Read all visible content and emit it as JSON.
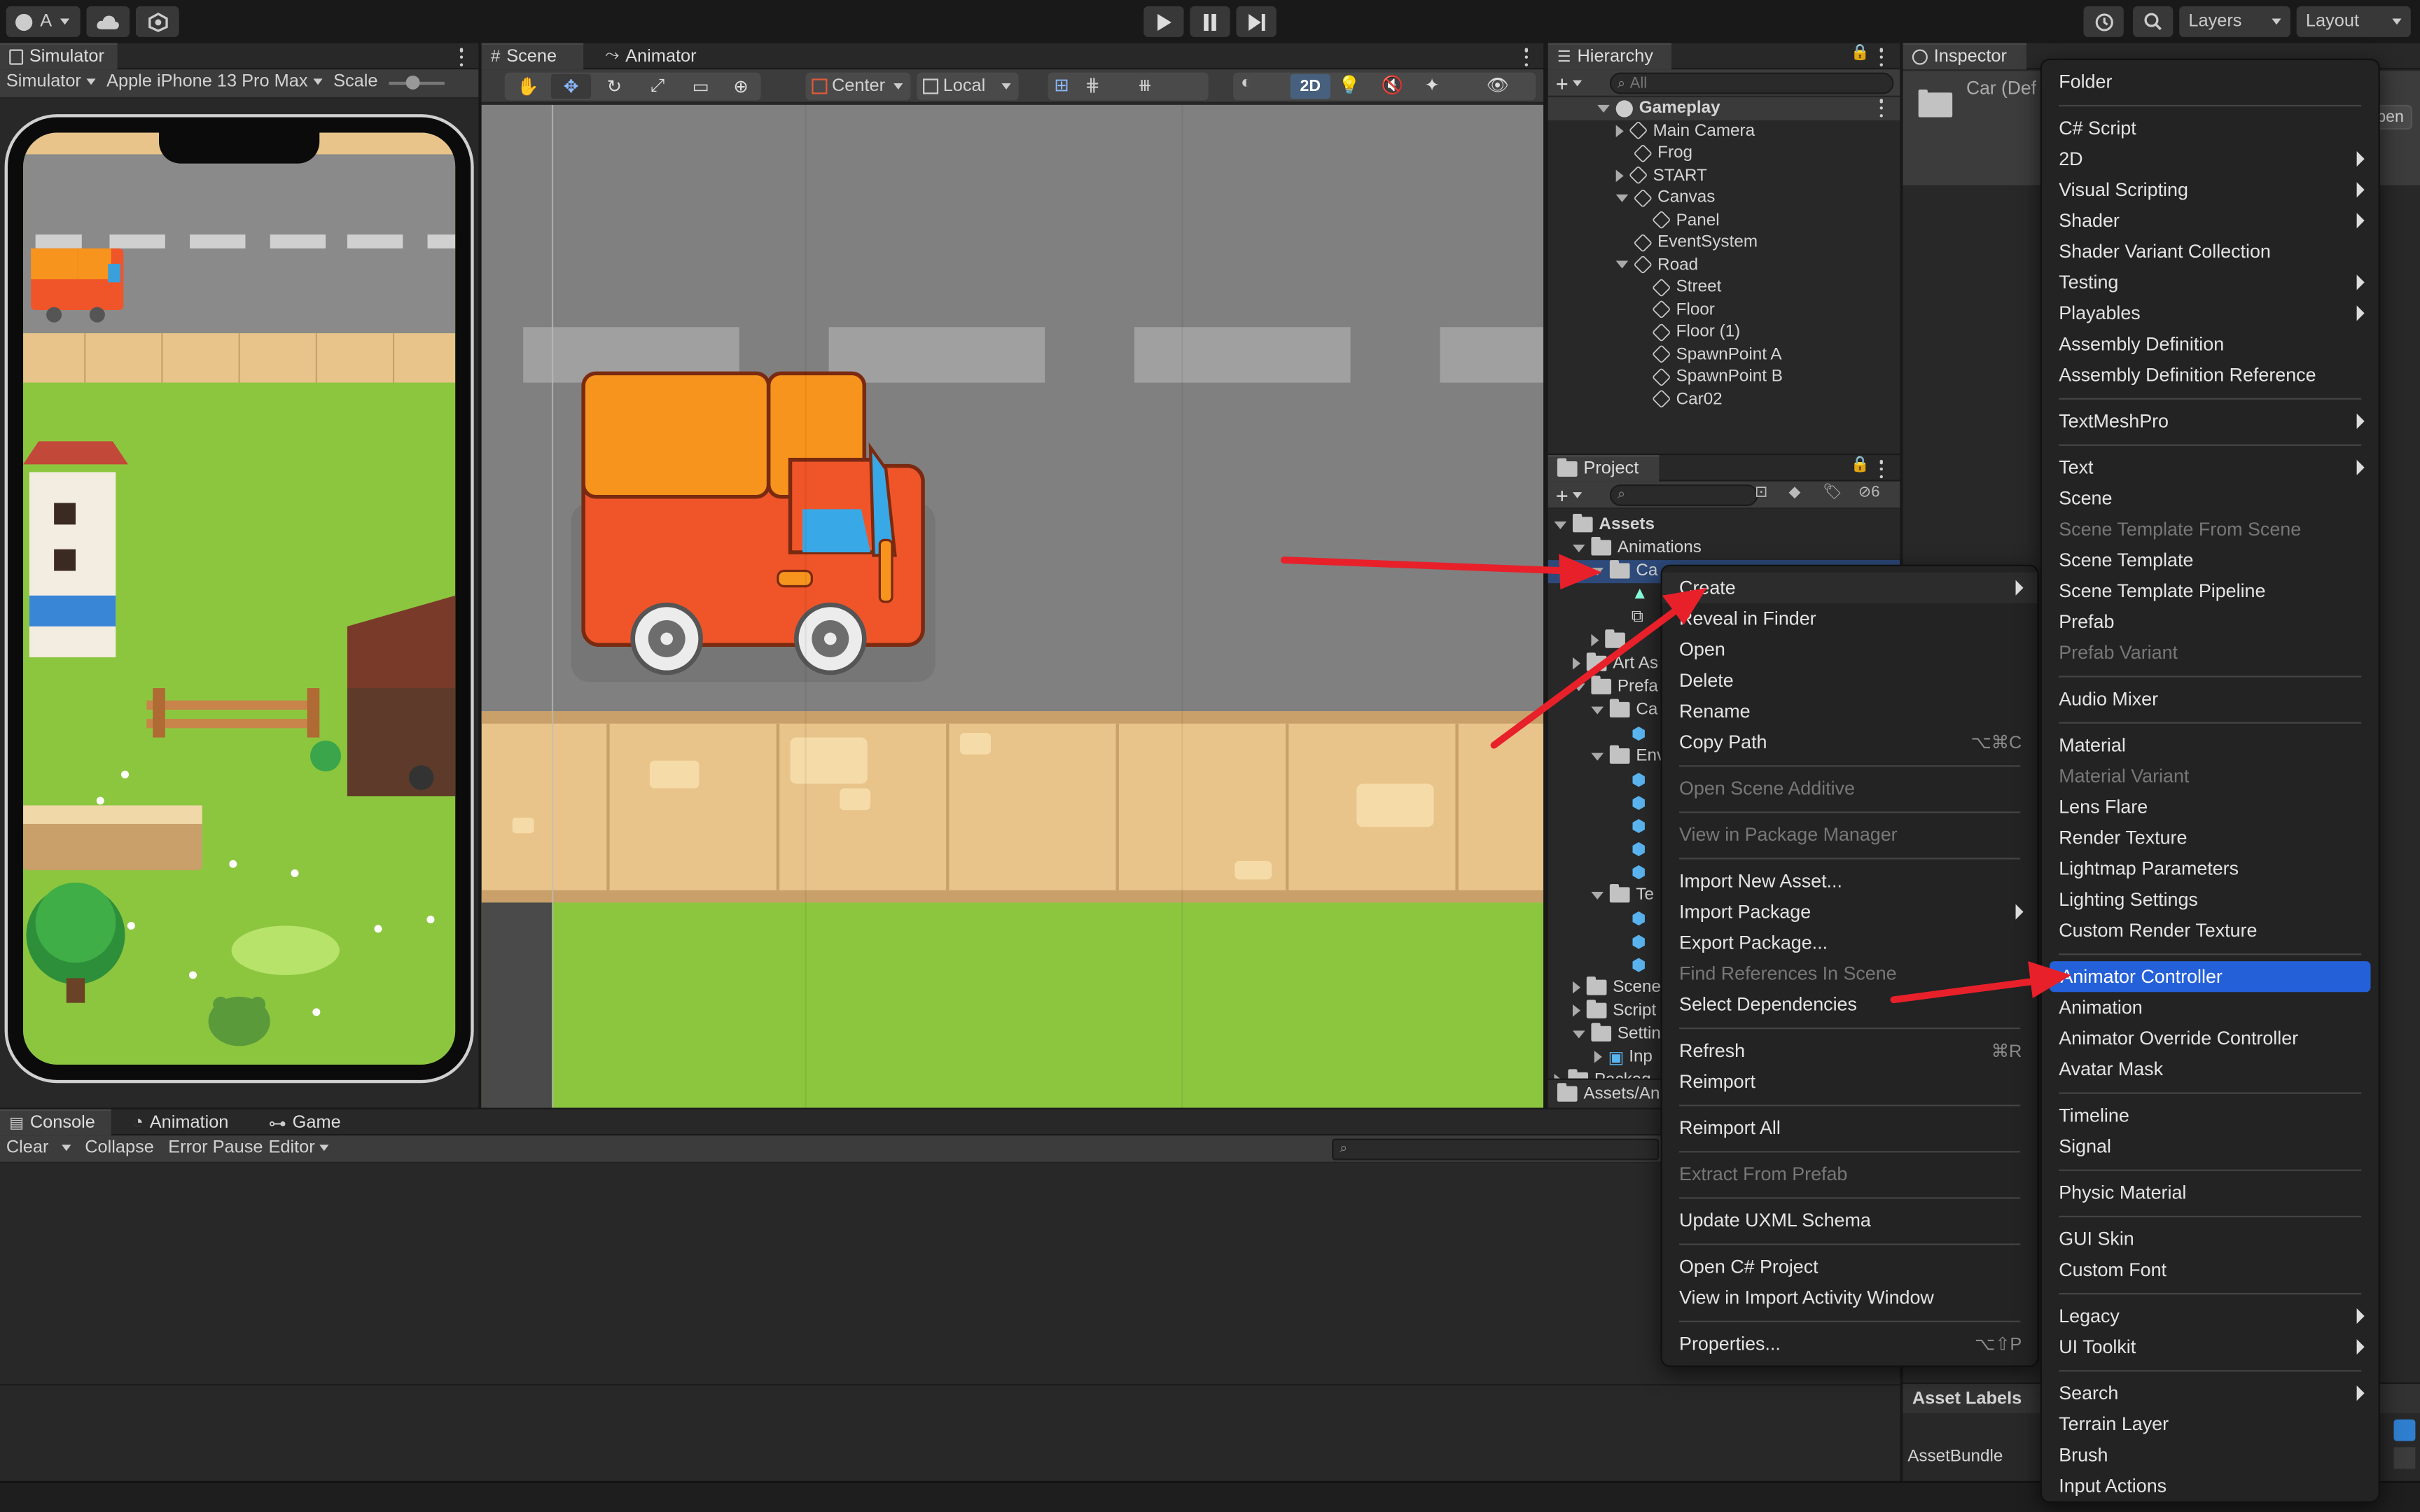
{
  "toolbar": {
    "account_label": "A",
    "layers_label": "Layers",
    "layout_label": "Layout"
  },
  "simulator": {
    "tab": "Simulator",
    "mode": "Simulator",
    "device": "Apple iPhone 13 Pro Max",
    "scale_label": "Scale"
  },
  "scene": {
    "tab_scene": "Scene",
    "tab_animator": "Animator",
    "pivot": "Center",
    "space": "Local",
    "mode_2d": "2D"
  },
  "hierarchy": {
    "tab": "Hierarchy",
    "search_placeholder": "All",
    "root": "Gameplay",
    "items": [
      {
        "label": "Main Camera",
        "indent": 1,
        "expander": "right"
      },
      {
        "label": "Frog",
        "indent": 1,
        "expander": "none"
      },
      {
        "label": "START",
        "indent": 1,
        "expander": "right"
      },
      {
        "label": "Canvas",
        "indent": 1,
        "expander": "down"
      },
      {
        "label": "Panel",
        "indent": 2,
        "expander": "none"
      },
      {
        "label": "EventSystem",
        "indent": 1,
        "expander": "none"
      },
      {
        "label": "Road",
        "indent": 1,
        "expander": "down"
      },
      {
        "label": "Street",
        "indent": 2,
        "expander": "none"
      },
      {
        "label": "Floor",
        "indent": 2,
        "expander": "none"
      },
      {
        "label": "Floor (1)",
        "indent": 2,
        "expander": "none"
      },
      {
        "label": "SpawnPoint A",
        "indent": 2,
        "expander": "none"
      },
      {
        "label": "SpawnPoint B",
        "indent": 2,
        "expander": "none"
      },
      {
        "label": "Car02",
        "indent": 2,
        "expander": "none"
      }
    ]
  },
  "project": {
    "tab": "Project",
    "hidden_count": "6",
    "assets": "Assets",
    "animations": "Animations",
    "selected_folder": "Ca",
    "visible_items": [
      "Art As",
      "Prefa",
      "Ca",
      "Env",
      "Te",
      "Scene",
      "Script",
      "Settin",
      "Inp",
      "Packag"
    ],
    "breadcrumb": "Assets/Ani"
  },
  "inspector": {
    "tab": "Inspector",
    "title": "Car (Def",
    "open_button": "pen",
    "asset_labels": "Asset Labels",
    "asset_bundle": "AssetBundle"
  },
  "console": {
    "tabs": [
      "Console",
      "Animation",
      "Game"
    ],
    "buttons": [
      "Clear",
      "Collapse",
      "Error Pause",
      "Editor"
    ]
  },
  "context_menu": {
    "items": [
      {
        "label": "Create",
        "submenu": true,
        "highlight_soft": true
      },
      {
        "label": "Reveal in Finder"
      },
      {
        "label": "Open"
      },
      {
        "label": "Delete"
      },
      {
        "label": "Rename"
      },
      {
        "label": "Copy Path",
        "shortcut": "⌥⌘C"
      },
      {
        "sep": true
      },
      {
        "label": "Open Scene Additive",
        "disabled": true
      },
      {
        "sep": true
      },
      {
        "label": "View in Package Manager",
        "disabled": true
      },
      {
        "sep": true
      },
      {
        "label": "Import New Asset..."
      },
      {
        "label": "Import Package",
        "submenu": true
      },
      {
        "label": "Export Package..."
      },
      {
        "label": "Find References In Scene",
        "disabled": true
      },
      {
        "label": "Select Dependencies"
      },
      {
        "sep": true
      },
      {
        "label": "Refresh",
        "shortcut": "⌘R"
      },
      {
        "label": "Reimport"
      },
      {
        "sep": true
      },
      {
        "label": "Reimport All"
      },
      {
        "sep": true
      },
      {
        "label": "Extract From Prefab",
        "disabled": true
      },
      {
        "sep": true
      },
      {
        "label": "Update UXML Schema"
      },
      {
        "sep": true
      },
      {
        "label": "Open C# Project"
      },
      {
        "label": "View in Import Activity Window"
      },
      {
        "sep": true
      },
      {
        "label": "Properties...",
        "shortcut": "⌥⇧P"
      }
    ]
  },
  "create_menu": {
    "items": [
      {
        "label": "Folder"
      },
      {
        "sep": true
      },
      {
        "label": "C# Script"
      },
      {
        "label": "2D",
        "submenu": true
      },
      {
        "label": "Visual Scripting",
        "submenu": true
      },
      {
        "label": "Shader",
        "submenu": true
      },
      {
        "label": "Shader Variant Collection"
      },
      {
        "label": "Testing",
        "submenu": true
      },
      {
        "label": "Playables",
        "submenu": true
      },
      {
        "label": "Assembly Definition"
      },
      {
        "label": "Assembly Definition Reference"
      },
      {
        "sep": true
      },
      {
        "label": "TextMeshPro",
        "submenu": true
      },
      {
        "sep": true
      },
      {
        "label": "Text",
        "submenu": true
      },
      {
        "label": "Scene"
      },
      {
        "label": "Scene Template From Scene",
        "disabled": true
      },
      {
        "label": "Scene Template"
      },
      {
        "label": "Scene Template Pipeline"
      },
      {
        "label": "Prefab"
      },
      {
        "label": "Prefab Variant",
        "disabled": true
      },
      {
        "sep": true
      },
      {
        "label": "Audio Mixer"
      },
      {
        "sep": true
      },
      {
        "label": "Material"
      },
      {
        "label": "Material Variant",
        "disabled": true
      },
      {
        "label": "Lens Flare"
      },
      {
        "label": "Render Texture"
      },
      {
        "label": "Lightmap Parameters"
      },
      {
        "label": "Lighting Settings"
      },
      {
        "label": "Custom Render Texture"
      },
      {
        "sep": true
      },
      {
        "label": "Animator Controller",
        "highlight": true
      },
      {
        "label": "Animation"
      },
      {
        "label": "Animator Override Controller"
      },
      {
        "label": "Avatar Mask"
      },
      {
        "sep": true
      },
      {
        "label": "Timeline"
      },
      {
        "label": "Signal"
      },
      {
        "sep": true
      },
      {
        "label": "Physic Material"
      },
      {
        "sep": true
      },
      {
        "label": "GUI Skin"
      },
      {
        "label": "Custom Font"
      },
      {
        "sep": true
      },
      {
        "label": "Legacy",
        "submenu": true
      },
      {
        "label": "UI Toolkit",
        "submenu": true
      },
      {
        "sep": true
      },
      {
        "label": "Search",
        "submenu": true
      },
      {
        "label": "Terrain Layer"
      },
      {
        "label": "Brush"
      },
      {
        "label": "Input Actions"
      }
    ]
  },
  "colors": {
    "accent": "#2460d8",
    "annotation_arrow": "#e8202a",
    "road": "#808080",
    "grass": "#8cc63f",
    "sidewalk": "#e8c48a",
    "truck_body": "#f0552a",
    "truck_cargo": "#f7941d"
  }
}
